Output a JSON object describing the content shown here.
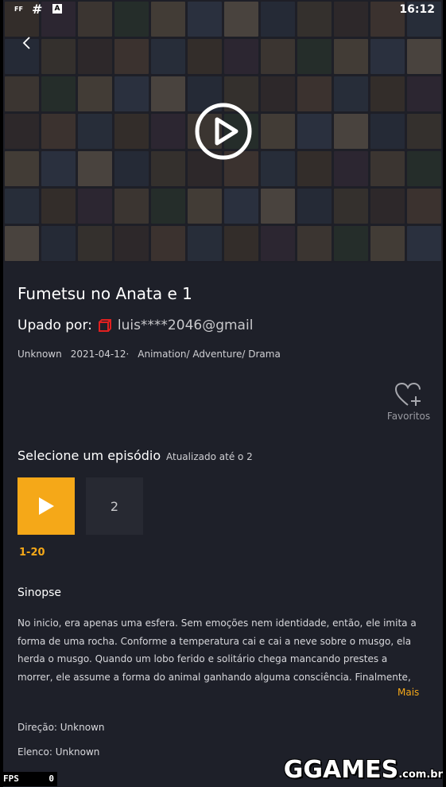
{
  "status_bar": {
    "left_icons": [
      "ff-icon",
      "hash-icon",
      "font-a-icon"
    ],
    "time": "16:12"
  },
  "hero": {
    "poster_colors": [
      "#5a4a3a",
      "#3b4456",
      "#6b5b4a",
      "#4d3f3a",
      "#7a6a55",
      "#3e4a5c",
      "#8a7a66",
      "#4a3a4a",
      "#5c5040",
      "#3a4a3a",
      "#6a5446",
      "#455066"
    ]
  },
  "details": {
    "title": "Fumetsu no Anata e 1",
    "uploader_label": "Upado por:",
    "uploader_email": "luis****2046@gmail",
    "meta": {
      "region": "Unknown",
      "date": "2021-04-12·",
      "genres": "Animation/ Adventure/ Drama"
    }
  },
  "favorite": {
    "label": "Favoritos"
  },
  "episodes": {
    "title": "Selecione um episódio",
    "updated": "Atualizado até o 2",
    "second": "2",
    "range": "1-20"
  },
  "synopsis": {
    "title": "Sinopse",
    "text": "No inicio, era apenas uma esfera. Sem emoções nem identidade, então, ele imita a forma de uma rocha. Conforme a temperatura cai e cai a neve sobre o musgo, ela herda o musgo. Quando um lobo ferido e solitário chega mancando prestes a morrer, ele assume a forma do animal ganhando alguma consciência. Finalmente, começa a percorrer a tundra vazia",
    "more": "Mais"
  },
  "credits": {
    "direction": "Direção: Unknown",
    "cast": "Elenco: Unknown"
  },
  "overlay": {
    "fps_label": "FPS",
    "fps_value": "0",
    "watermark": "GGAMES",
    "watermark_tld": ".com.br"
  },
  "colors": {
    "accent": "#f5a818",
    "background": "#1e2029",
    "tile": "#272932",
    "uploader_icon": "#e02020"
  }
}
